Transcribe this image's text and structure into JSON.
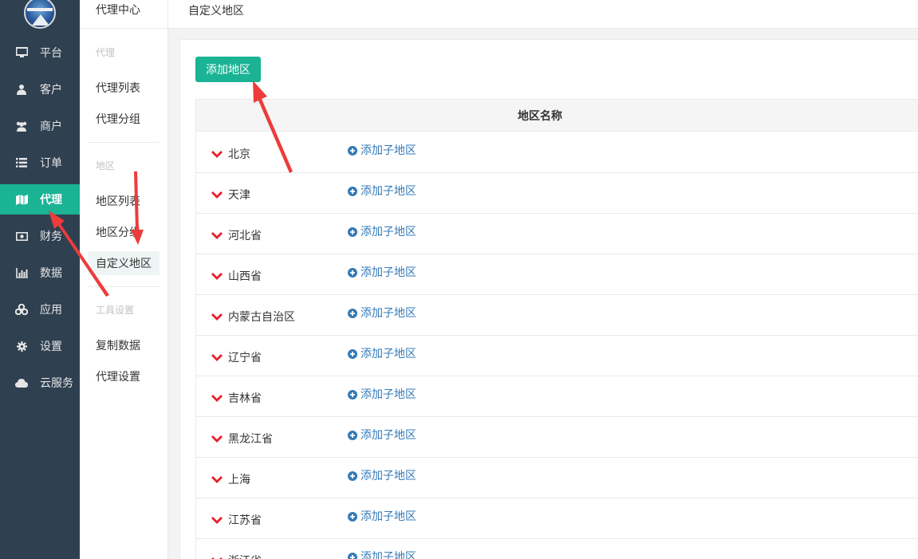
{
  "nav": {
    "items": [
      {
        "label": "平台",
        "icon": "monitor-icon"
      },
      {
        "label": "客户",
        "icon": "user-icon"
      },
      {
        "label": "商户",
        "icon": "users-icon"
      },
      {
        "label": "订单",
        "icon": "list-icon"
      },
      {
        "label": "代理",
        "icon": "map-icon"
      },
      {
        "label": "财务",
        "icon": "money-icon"
      },
      {
        "label": "数据",
        "icon": "bar-chart-icon"
      },
      {
        "label": "应用",
        "icon": "cubes-icon"
      },
      {
        "label": "设置",
        "icon": "gear-icon"
      },
      {
        "label": "云服务",
        "icon": "cloud-icon"
      }
    ],
    "active_index": 4
  },
  "subnav": {
    "title": "代理中心",
    "group_agent": "代理",
    "item_agent_list": "代理列表",
    "item_agent_group": "代理分组",
    "group_region": "地区",
    "item_region_list": "地区列表",
    "item_region_group": "地区分组",
    "item_custom_region": "自定义地区",
    "group_tools": "工具设置",
    "item_copy_data": "复制数据",
    "item_agent_settings": "代理设置"
  },
  "breadcrumb": "自定义地区",
  "toolbar": {
    "add_region_label": "添加地区"
  },
  "table": {
    "header": "地区名称",
    "add_sub_label": "添加子地区",
    "rows": [
      "北京",
      "天津",
      "河北省",
      "山西省",
      "内蒙古自治区",
      "辽宁省",
      "吉林省",
      "黑龙江省",
      "上海",
      "江苏省",
      "浙江省"
    ]
  },
  "colors": {
    "accent": "#1ab394",
    "sidebar": "#2f4050",
    "chevron": "#e8202a",
    "link": "#337ab7",
    "annotation_arrow": "#ee3b3b"
  }
}
